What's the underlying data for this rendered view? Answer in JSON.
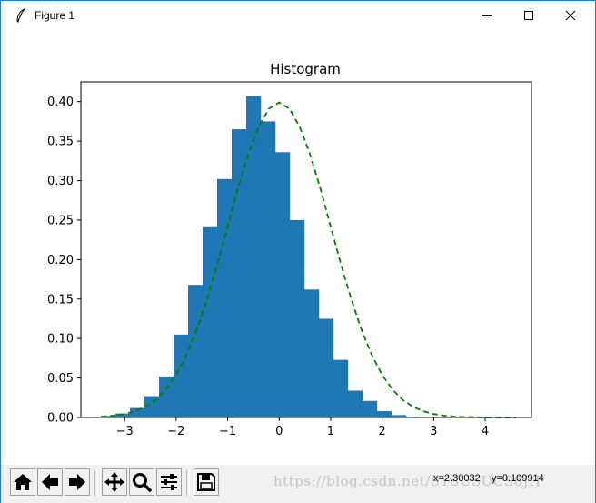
{
  "window": {
    "title": "Figure 1",
    "buttons": [
      "minimize",
      "maximize",
      "close"
    ]
  },
  "chart_data": {
    "type": "bar",
    "title": "Histogram",
    "xlabel": "",
    "ylabel": "",
    "xlim": [
      -3.85,
      4.9
    ],
    "ylim": [
      0.0,
      0.425
    ],
    "xticks": [
      "−3",
      "−2",
      "−1",
      "0",
      "1",
      "2",
      "3",
      "4"
    ],
    "xtick_values": [
      -3,
      -2,
      -1,
      0,
      1,
      2,
      3,
      4
    ],
    "yticks": [
      "0.00",
      "0.05",
      "0.10",
      "0.15",
      "0.20",
      "0.25",
      "0.30",
      "0.35",
      "0.40"
    ],
    "ytick_values": [
      0.0,
      0.05,
      0.1,
      0.15,
      0.2,
      0.25,
      0.3,
      0.35,
      0.4
    ],
    "bin_width": 0.282,
    "bins_start": -3.46,
    "values": [
      0.002,
      0.005,
      0.012,
      0.027,
      0.052,
      0.105,
      0.168,
      0.241,
      0.302,
      0.365,
      0.407,
      0.375,
      0.336,
      0.25,
      0.162,
      0.125,
      0.073,
      0.034,
      0.021,
      0.008,
      0.003,
      0.001,
      0.0005,
      0.0003,
      0.0002
    ],
    "curve": {
      "style": "dashed",
      "color": "#008000",
      "x": [
        -3.46,
        -3.2,
        -3.0,
        -2.8,
        -2.6,
        -2.4,
        -2.2,
        -2.0,
        -1.8,
        -1.6,
        -1.4,
        -1.2,
        -1.0,
        -0.8,
        -0.6,
        -0.4,
        -0.2,
        0.0,
        0.2,
        0.4,
        0.6,
        0.8,
        1.0,
        1.2,
        1.4,
        1.6,
        1.8,
        2.0,
        2.2,
        2.4,
        2.6,
        2.8,
        3.0,
        3.2,
        3.4,
        3.6,
        3.8,
        4.0,
        4.2,
        4.4,
        4.6
      ],
      "y": [
        0.001,
        0.0024,
        0.0044,
        0.0079,
        0.0136,
        0.0224,
        0.0355,
        0.054,
        0.079,
        0.111,
        0.15,
        0.194,
        0.242,
        0.29,
        0.333,
        0.368,
        0.391,
        0.399,
        0.391,
        0.368,
        0.333,
        0.29,
        0.242,
        0.194,
        0.15,
        0.111,
        0.079,
        0.054,
        0.0355,
        0.0224,
        0.0136,
        0.0079,
        0.0044,
        0.0024,
        0.0012,
        0.0006,
        0.0003,
        0.0001,
        5e-05,
        2e-05,
        1e-05
      ]
    },
    "bar_color": "#1f77b4",
    "grid": false
  },
  "toolbar": {
    "buttons": [
      "home-icon",
      "back-arrow-icon",
      "forward-arrow-icon",
      "pan-icon",
      "zoom-icon",
      "configure-subplots-icon",
      "save-icon"
    ],
    "coords": "x=2.30032    y=0.109914",
    "watermark": "https://blog.csdn.net/SYSUSUCS6JH"
  }
}
